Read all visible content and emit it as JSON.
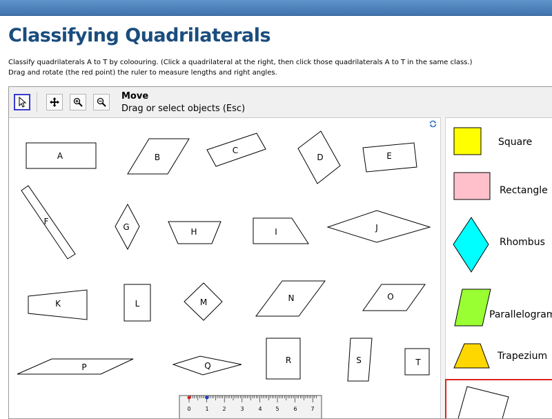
{
  "page": {
    "title": "Classifying Quadrilaterals",
    "instructions": [
      "Classify quadrilaterals A to T by coloouring. (Click a quadrilateral at the right, then click those quadrilaterals A to T in the same class.)",
      "Drag and rotate (the red point) the ruler to measure lengths and right angles."
    ]
  },
  "toolbar": {
    "active_tool_name": "Move",
    "active_tool_help": "Drag or select objects (Esc)",
    "tools": [
      {
        "icon": "pointer-arrow-icon",
        "selected": true
      },
      {
        "icon": "move-arrows-icon",
        "selected": false
      },
      {
        "icon": "zoom-in-icon",
        "selected": false
      },
      {
        "icon": "zoom-out-icon",
        "selected": false
      }
    ]
  },
  "shapes": [
    "A",
    "B",
    "C",
    "D",
    "E",
    "F",
    "G",
    "H",
    "I",
    "J",
    "K",
    "L",
    "M",
    "N",
    "O",
    "P",
    "Q",
    "R",
    "S",
    "T"
  ],
  "ruler": {
    "ticks": [
      "0",
      "1",
      "2",
      "3",
      "4",
      "5",
      "6",
      "7"
    ]
  },
  "legend": [
    {
      "label": "Square",
      "color": "#ffff00"
    },
    {
      "label": "Rectangle",
      "color": "#ffc0cb"
    },
    {
      "label": "Rhombus",
      "color": "#00ffff"
    },
    {
      "label": "Parallelogram",
      "color": "#99ff33"
    },
    {
      "label": "Trapezium",
      "color": "#ffd700"
    }
  ],
  "colors": {
    "header_bar": "#4a7fb8",
    "title": "#1a4d7e",
    "selected_tool_border": "#3a3ad0",
    "legend_selection": "#e02020"
  },
  "icons": {
    "refresh": "refresh-icon"
  }
}
